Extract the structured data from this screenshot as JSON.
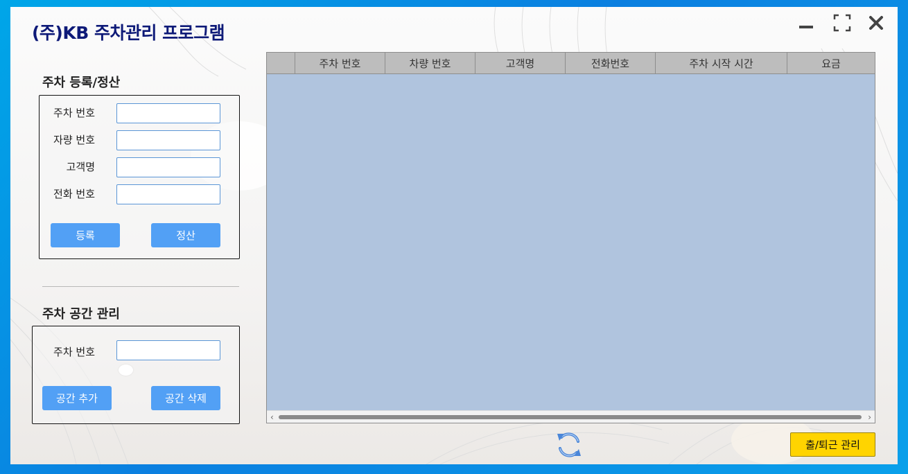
{
  "app": {
    "title": "(주)KB 주차관리 프로그램"
  },
  "window_controls": {
    "minimize_icon": "minimize-icon",
    "maximize_icon": "maximize-icon",
    "close_icon": "close-icon"
  },
  "register": {
    "title": "주차 등록/정산",
    "fields": [
      {
        "label": "주차 번호",
        "value": ""
      },
      {
        "label": "자량 번호",
        "value": ""
      },
      {
        "label": "고객명",
        "value": ""
      },
      {
        "label": "전화 번호",
        "value": ""
      }
    ],
    "register_button": "등록",
    "settle_button": "정산"
  },
  "space": {
    "title": "주차 공간 관리",
    "field_label": "주차 번호",
    "field_value": "",
    "add_button": "공간 추가",
    "delete_button": "공간 삭제"
  },
  "grid": {
    "columns": [
      "",
      "주차 번호",
      "차량 번호",
      "고객명",
      "전화번호",
      "주차 시작 시간",
      "요금"
    ],
    "rows": []
  },
  "footer": {
    "refresh_icon": "refresh-icon",
    "attendance_button": "출/퇴근 관리"
  },
  "colors": {
    "title": "#0e1a78",
    "button": "#52a0f5",
    "grid_body": "#b0c4de",
    "grid_header": "#bdbdbd",
    "attendance_button": "#ffd400"
  }
}
